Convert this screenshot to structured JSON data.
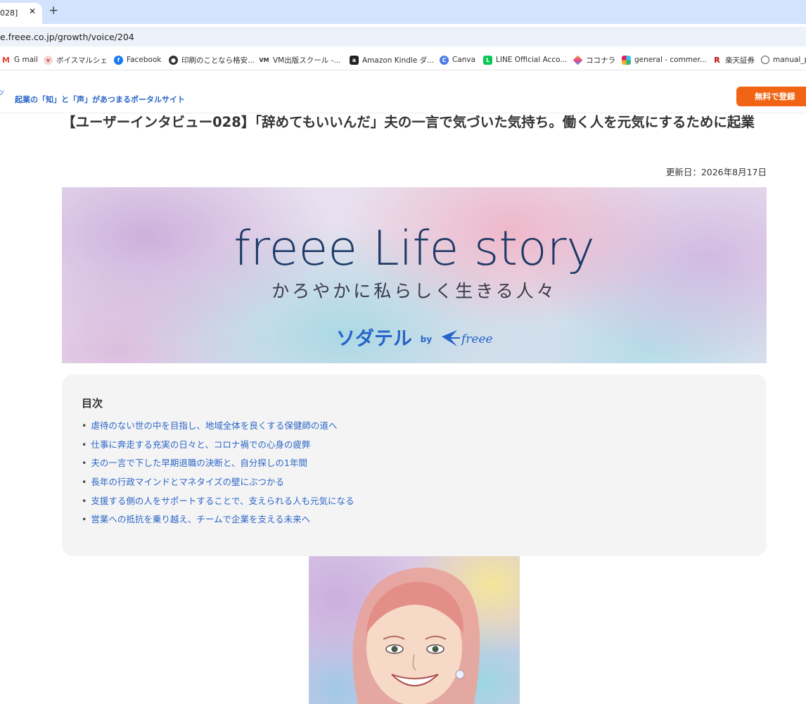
{
  "browser": {
    "tab_title": "028]",
    "tab_close": "✕",
    "new_tab": "+",
    "url": "e.freee.co.jp/growth/voice/204"
  },
  "bookmarks": [
    {
      "label": "G mail",
      "icon": "gmail-icon",
      "color": "#ea4335"
    },
    {
      "label": "ボイスマルシェ",
      "icon": "voice-marche-icon",
      "color": "#c0392b"
    },
    {
      "label": "Facebook",
      "icon": "facebook-icon",
      "color": "#1877f2"
    },
    {
      "label": "印刷のことなら格安...",
      "icon": "print-icon",
      "color": "#333333"
    },
    {
      "label": "VM出版スクール -...",
      "icon": "vm-icon",
      "color": "#333333"
    },
    {
      "label": "Amazon Kindle ダ...",
      "icon": "kindle-icon",
      "color": "#222222"
    },
    {
      "label": "Canva",
      "icon": "canva-icon",
      "color": "#4a7ce8"
    },
    {
      "label": "LINE Official Acco...",
      "icon": "line-icon",
      "color": "#06c755"
    },
    {
      "label": "ココナラ",
      "icon": "coconala-icon",
      "color": "#e8478b"
    },
    {
      "label": "general - commer...",
      "icon": "slack-icon",
      "color": "#e01e5a"
    },
    {
      "label": "楽天証券",
      "icon": "rakuten-icon",
      "color": "#bf0000"
    },
    {
      "label": "manual_p",
      "icon": "globe-icon",
      "color": "#555555"
    }
  ],
  "site": {
    "tagline": "起業の「知」と「声」があつまるポータルサイト",
    "signup_label": "無料で登録",
    "brand_color": "#2864c8",
    "accent_color": "#f06414"
  },
  "article": {
    "title": "【ユーザーインタビュー028】「辞めてもいいんだ」夫の一言で気づいた気持ち。働く人を元気にするために起業",
    "updated": "更新日：2026年8月17日"
  },
  "banner": {
    "headline": "freee Life story",
    "subline": "かろやかに私らしく生きる人々",
    "brand": "ソダテル",
    "by": "by",
    "partner": "freee"
  },
  "toc": {
    "heading": "目次",
    "items": [
      "虐待のない世の中を目指し、地域全体を良くする保健師の道へ",
      "仕事に奔走する充実の日々と、コロナ禍での心身の疲弊",
      "夫の一言で下した早期退職の決断と、自分探しの1年間",
      "長年の行政マインドとマネタイズの壁にぶつかる",
      "支援する側の人をサポートすることで、支えられる人も元気になる",
      "営業への抵抗を乗り越え、チームで企業を支える未来へ"
    ]
  }
}
